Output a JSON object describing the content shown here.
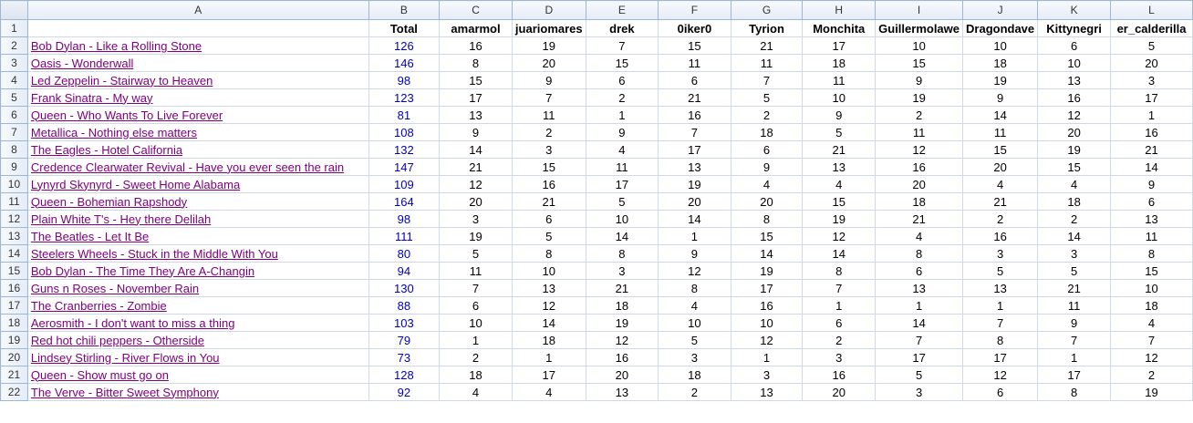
{
  "sheet": {
    "column_letters": [
      "A",
      "B",
      "C",
      "D",
      "E",
      "F",
      "G",
      "H",
      "I",
      "J",
      "K",
      "L"
    ],
    "header_row": {
      "row_number": "1",
      "cells": [
        "",
        "Total",
        "amarmol",
        "juariomares",
        "drek",
        "0iker0",
        "Tyrion",
        "Monchita",
        "Guillermolawe",
        "Dragondave",
        "Kittynegri",
        "er_calderilla"
      ]
    },
    "rows": [
      {
        "n": "2",
        "song": "Bob Dylan - Like a Rolling Stone",
        "total": "126",
        "votes": [
          "16",
          "19",
          "7",
          "15",
          "21",
          "17",
          "10",
          "10",
          "6",
          "5"
        ]
      },
      {
        "n": "3",
        "song": "Oasis - Wonderwall",
        "total": "146",
        "votes": [
          "8",
          "20",
          "15",
          "11",
          "11",
          "18",
          "15",
          "18",
          "10",
          "20"
        ]
      },
      {
        "n": "4",
        "song": "Led Zeppelin - Stairway to Heaven",
        "total": "98",
        "votes": [
          "15",
          "9",
          "6",
          "6",
          "7",
          "11",
          "9",
          "19",
          "13",
          "3"
        ]
      },
      {
        "n": "5",
        "song": "Frank Sinatra - My way",
        "total": "123",
        "votes": [
          "17",
          "7",
          "2",
          "21",
          "5",
          "10",
          "19",
          "9",
          "16",
          "17"
        ]
      },
      {
        "n": "6",
        "song": "Queen - Who Wants To Live Forever",
        "total": "81",
        "votes": [
          "13",
          "11",
          "1",
          "16",
          "2",
          "9",
          "2",
          "14",
          "12",
          "1"
        ]
      },
      {
        "n": "7",
        "song": "Metallica - Nothing else matters",
        "total": "108",
        "votes": [
          "9",
          "2",
          "9",
          "7",
          "18",
          "5",
          "11",
          "11",
          "20",
          "16"
        ]
      },
      {
        "n": "8",
        "song": "The Eagles - Hotel California",
        "total": "132",
        "votes": [
          "14",
          "3",
          "4",
          "17",
          "6",
          "21",
          "12",
          "15",
          "19",
          "21"
        ]
      },
      {
        "n": "9",
        "song": "Credence Clearwater Revival - Have you ever seen the rain",
        "total": "147",
        "votes": [
          "21",
          "15",
          "11",
          "13",
          "9",
          "13",
          "16",
          "20",
          "15",
          "14"
        ]
      },
      {
        "n": "10",
        "song": "Lynyrd Skynyrd - Sweet Home Alabama",
        "total": "109",
        "votes": [
          "12",
          "16",
          "17",
          "19",
          "4",
          "4",
          "20",
          "4",
          "4",
          "9"
        ]
      },
      {
        "n": "11",
        "song": "Queen - Bohemian Rapshody",
        "total": "164",
        "votes": [
          "20",
          "21",
          "5",
          "20",
          "20",
          "15",
          "18",
          "21",
          "18",
          "6"
        ]
      },
      {
        "n": "12",
        "song": "Plain White T's - Hey there Delilah",
        "total": "98",
        "votes": [
          "3",
          "6",
          "10",
          "14",
          "8",
          "19",
          "21",
          "2",
          "2",
          "13"
        ]
      },
      {
        "n": "13",
        "song": "The Beatles - Let It Be",
        "total": "111",
        "votes": [
          "19",
          "5",
          "14",
          "1",
          "15",
          "12",
          "4",
          "16",
          "14",
          "11"
        ]
      },
      {
        "n": "14",
        "song": "Steelers Wheels - Stuck in the Middle With You",
        "total": "80",
        "votes": [
          "5",
          "8",
          "8",
          "9",
          "14",
          "14",
          "8",
          "3",
          "3",
          "8"
        ]
      },
      {
        "n": "15",
        "song": "Bob Dylan - The Time They Are A-Changin",
        "total": "94",
        "votes": [
          "11",
          "10",
          "3",
          "12",
          "19",
          "8",
          "6",
          "5",
          "5",
          "15"
        ]
      },
      {
        "n": "16",
        "song": "Guns n Roses - November Rain",
        "total": "130",
        "votes": [
          "7",
          "13",
          "21",
          "8",
          "17",
          "7",
          "13",
          "13",
          "21",
          "10"
        ]
      },
      {
        "n": "17",
        "song": "The Cranberries - Zombie",
        "total": "88",
        "votes": [
          "6",
          "12",
          "18",
          "4",
          "16",
          "1",
          "1",
          "1",
          "11",
          "18"
        ]
      },
      {
        "n": "18",
        "song": "Aerosmith - I don't want to miss a thing",
        "total": "103",
        "votes": [
          "10",
          "14",
          "19",
          "10",
          "10",
          "6",
          "14",
          "7",
          "9",
          "4"
        ]
      },
      {
        "n": "19",
        "song": "Red hot chili peppers - Otherside",
        "total": "79",
        "votes": [
          "1",
          "18",
          "12",
          "5",
          "12",
          "2",
          "7",
          "8",
          "7",
          "7"
        ]
      },
      {
        "n": "20",
        "song": "Lindsey Stirling - River Flows in You",
        "total": "73",
        "votes": [
          "2",
          "1",
          "16",
          "3",
          "1",
          "3",
          "17",
          "17",
          "1",
          "12"
        ]
      },
      {
        "n": "21",
        "song": "Queen - Show must go on",
        "total": "128",
        "votes": [
          "18",
          "17",
          "20",
          "18",
          "3",
          "16",
          "5",
          "12",
          "17",
          "2"
        ]
      },
      {
        "n": "22",
        "song": "The Verve - Bitter Sweet Symphony",
        "total": "92",
        "votes": [
          "4",
          "4",
          "13",
          "2",
          "13",
          "20",
          "3",
          "6",
          "8",
          "19"
        ]
      }
    ]
  },
  "colors": {
    "link_text": "#800080",
    "total_text": "#0000c0",
    "gridline": "#d0d7e5",
    "header_bg": "#e4ecf7"
  }
}
